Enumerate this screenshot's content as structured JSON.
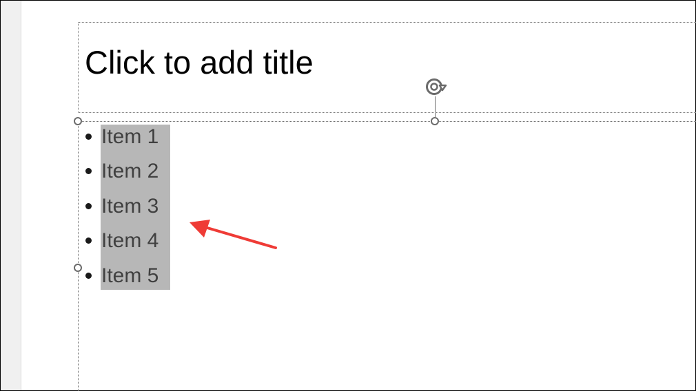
{
  "slide": {
    "title_placeholder": "Click to add title",
    "bullets": [
      {
        "label": "Item 1"
      },
      {
        "label": "Item 2"
      },
      {
        "label": "Item 3"
      },
      {
        "label": "Item 4"
      },
      {
        "label": "Item 5"
      }
    ]
  },
  "icons": {
    "rotate_handle": "rotate-icon",
    "annotation_arrow": "arrow-icon"
  },
  "colors": {
    "selection_highlight": "#b7b7b7",
    "annotation_arrow": "#ef3b36",
    "handle_stroke": "#6b6b6b"
  }
}
